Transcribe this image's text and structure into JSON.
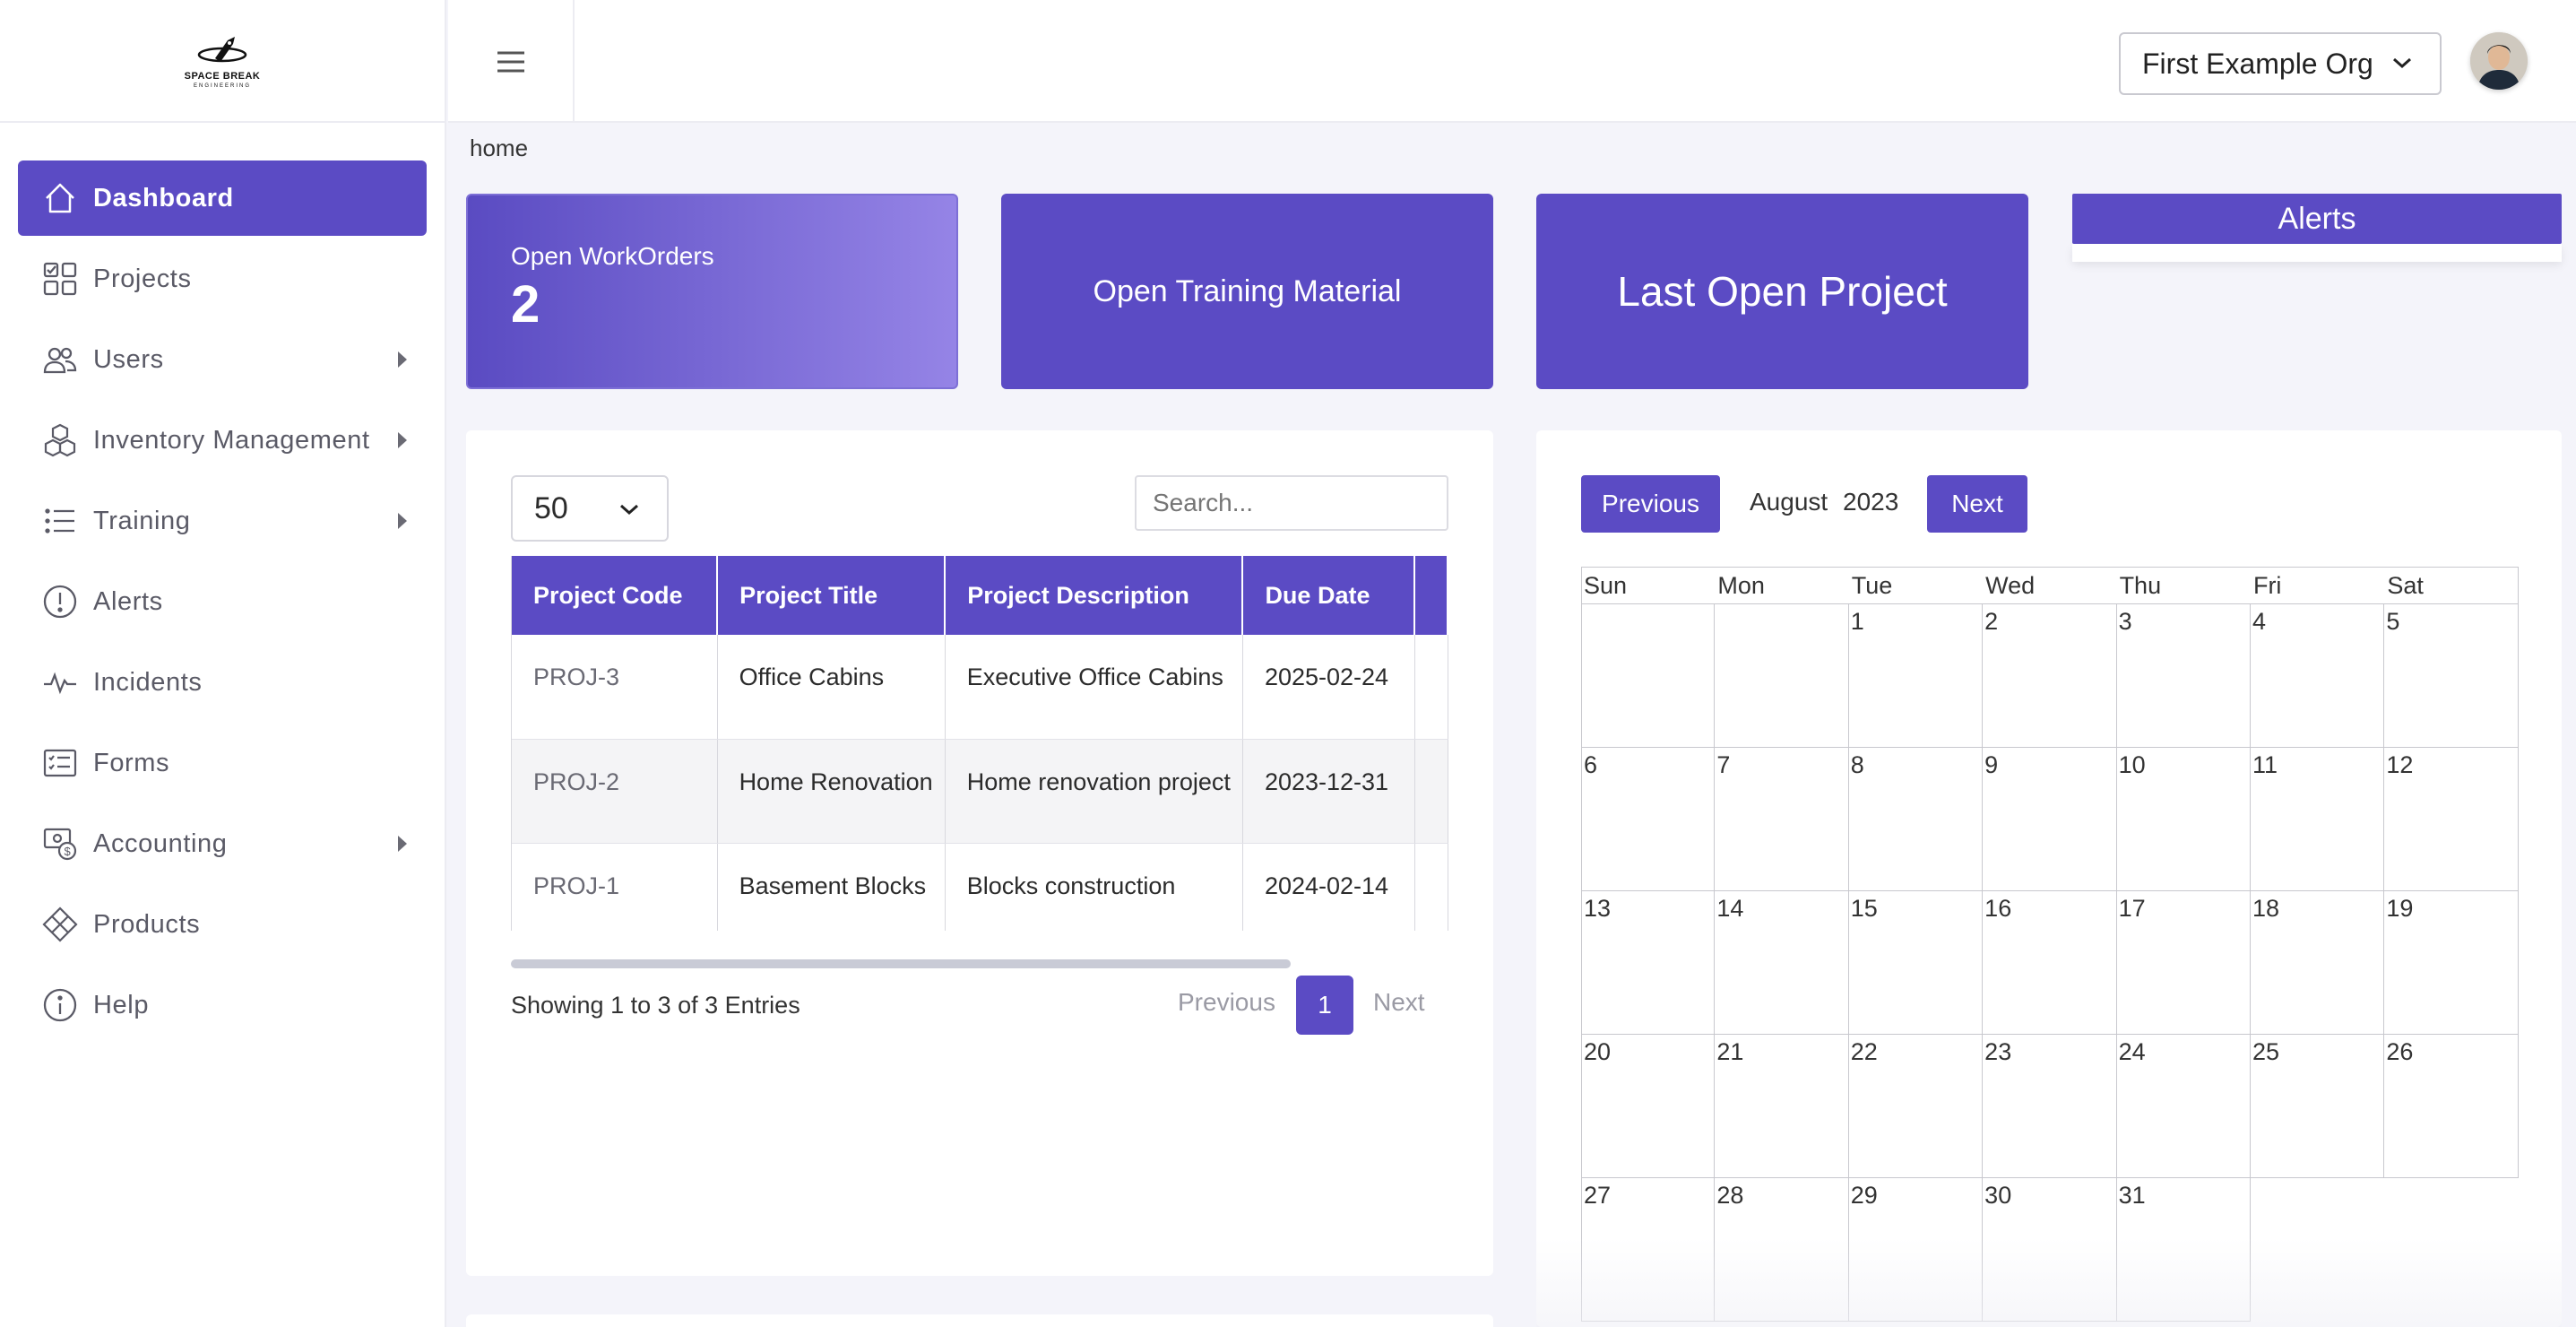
{
  "logo": {
    "text": "SPACE BREAK",
    "subtext": "ENGINEERING"
  },
  "sidebar": {
    "items": [
      {
        "label": "Dashboard",
        "icon": "home-icon",
        "active": true,
        "has_submenu": false
      },
      {
        "label": "Projects",
        "icon": "grid-icon",
        "active": false,
        "has_submenu": false
      },
      {
        "label": "Users",
        "icon": "users-icon",
        "active": false,
        "has_submenu": true
      },
      {
        "label": "Inventory Management",
        "icon": "boxes-icon",
        "active": false,
        "has_submenu": true
      },
      {
        "label": "Training",
        "icon": "list-icon",
        "active": false,
        "has_submenu": true
      },
      {
        "label": "Alerts",
        "icon": "exclamation-circle-icon",
        "active": false,
        "has_submenu": false
      },
      {
        "label": "Incidents",
        "icon": "activity-icon",
        "active": false,
        "has_submenu": false
      },
      {
        "label": "Forms",
        "icon": "checklist-icon",
        "active": false,
        "has_submenu": false
      },
      {
        "label": "Accounting",
        "icon": "money-icon",
        "active": false,
        "has_submenu": true
      },
      {
        "label": "Products",
        "icon": "diamond-icon",
        "active": false,
        "has_submenu": false
      },
      {
        "label": "Help",
        "icon": "info-icon",
        "active": false,
        "has_submenu": false
      }
    ]
  },
  "topbar": {
    "org_selected": "First Example Org"
  },
  "breadcrumb": "home",
  "cards": {
    "open_workorders_label": "Open WorkOrders",
    "open_workorders_count": "2",
    "training_label": "Open Training Material",
    "project_label": "Last Open Project",
    "alerts_title": "Alerts"
  },
  "projects_table": {
    "per_page": "50",
    "search_placeholder": "Search...",
    "columns": [
      "Project Code",
      "Project Title",
      "Project Description",
      "Due Date"
    ],
    "rows": [
      [
        "PROJ-3",
        "Office Cabins",
        "Executive Office Cabins",
        "2025-02-24"
      ],
      [
        "PROJ-2",
        "Home Renovation",
        "Home renovation project",
        "2023-12-31"
      ],
      [
        "PROJ-1",
        "Basement Blocks",
        "Blocks construction",
        "2024-02-14"
      ]
    ],
    "showing": "Showing 1 to 3 of 3 Entries",
    "pagination": {
      "previous": "Previous",
      "current_page": "1",
      "next": "Next"
    }
  },
  "calendar": {
    "previous": "Previous",
    "next": "Next",
    "month": "August",
    "year": "2023",
    "weekdays": [
      "Sun",
      "Mon",
      "Tue",
      "Wed",
      "Thu",
      "Fri",
      "Sat"
    ],
    "first_weekday_index": 2,
    "days_in_month": 31
  },
  "colors": {
    "accent": "#5b4bc4",
    "accent_light": "#9584e6"
  }
}
